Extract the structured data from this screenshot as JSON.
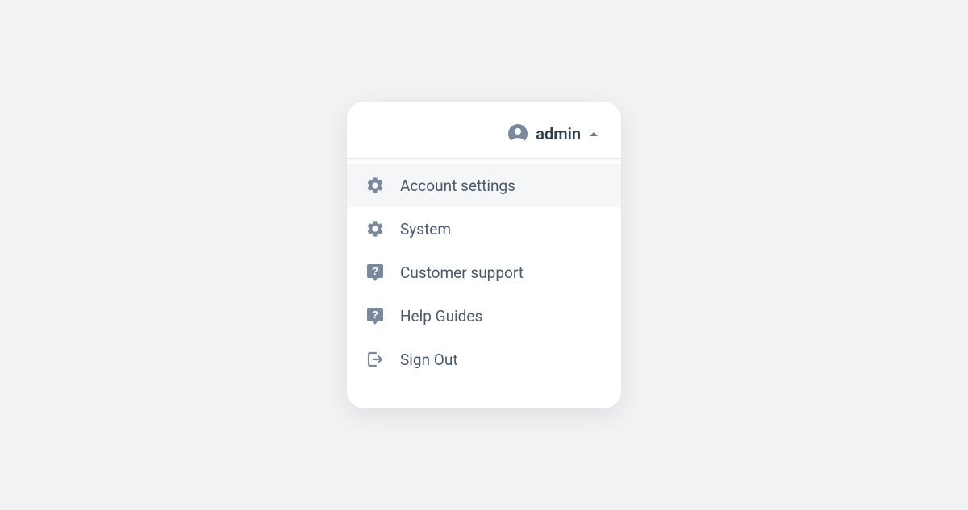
{
  "header": {
    "username": "admin"
  },
  "menu": {
    "items": [
      {
        "label": "Account settings",
        "icon": "gear",
        "hovered": true
      },
      {
        "label": "System",
        "icon": "gear",
        "hovered": false
      },
      {
        "label": "Customer support",
        "icon": "help",
        "hovered": false
      },
      {
        "label": "Help Guides",
        "icon": "help",
        "hovered": false
      },
      {
        "label": "Sign Out",
        "icon": "signout",
        "hovered": false
      }
    ]
  }
}
